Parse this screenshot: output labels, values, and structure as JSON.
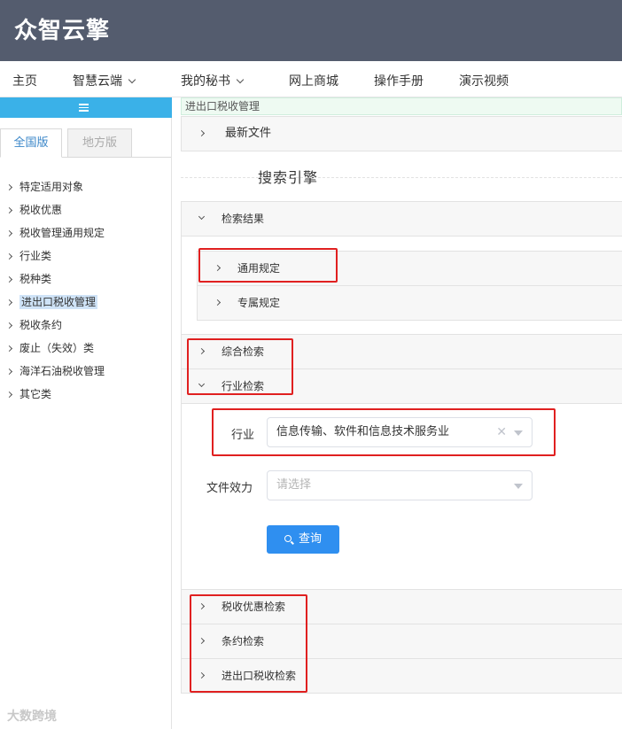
{
  "header": {
    "logo_text": "众智云擎"
  },
  "nav": {
    "items": [
      {
        "label": "主页",
        "dropdown": false
      },
      {
        "label": "智慧云端",
        "dropdown": true
      },
      {
        "label": "我的秘书",
        "dropdown": true
      },
      {
        "label": "网上商城",
        "dropdown": false
      },
      {
        "label": "操作手册",
        "dropdown": false
      },
      {
        "label": "演示视频",
        "dropdown": false
      }
    ]
  },
  "sidebar": {
    "tabs": [
      "全国版",
      "地方版"
    ],
    "active_tab": "全国版",
    "items": [
      "特定适用对象",
      "税收优惠",
      "税收管理通用规定",
      "行业类",
      "税种类",
      "进出口税收管理",
      "税收条约",
      "废止（失效）类",
      "海洋石油税收管理",
      "其它类"
    ],
    "selected_item": "进出口税收管理"
  },
  "main": {
    "breadcrumb": "进出口税收管理",
    "latest_files": "最新文件",
    "search_title": "搜索引擎",
    "results_label": "检索结果",
    "result_items": [
      "通用规定",
      "专属规定"
    ],
    "comprehensive": "综合检索",
    "industry_search": "行业检索",
    "form": {
      "industry_label": "行业",
      "industry_value": "信息传输、软件和信息技术服务业",
      "effect_label": "文件效力",
      "effect_placeholder": "请选择",
      "query_button": "查询"
    },
    "bottom_items": [
      "税收优惠检索",
      "条约检索",
      "进出口税收检索"
    ]
  },
  "watermark": "大数跨境",
  "colors": {
    "header_bg": "#545c6e",
    "sidebar_toggle": "#3ab1e8",
    "primary_button": "#2f8ff0",
    "annotation_red": "#e02020"
  }
}
